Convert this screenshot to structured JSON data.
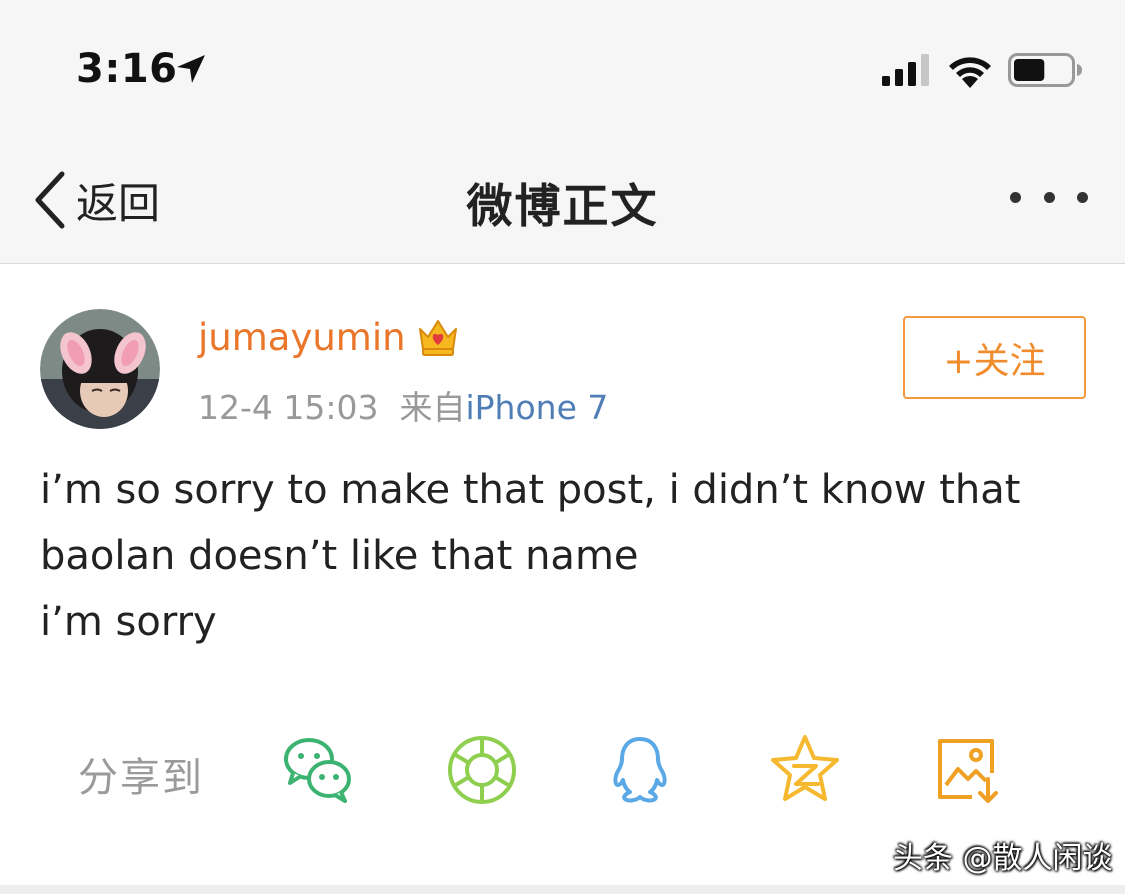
{
  "status_bar": {
    "time": "3:16",
    "location_icon": "location-arrow-icon",
    "signal_icon": "cellular-signal-icon",
    "wifi_icon": "wifi-icon",
    "battery_icon": "battery-icon",
    "battery_level": 0.55
  },
  "nav": {
    "back_label": "返回",
    "title": "微博正文",
    "more_icon": "more-dots-icon"
  },
  "post": {
    "username": "jumayumin",
    "badge_icon": "crown-icon",
    "timestamp": "12-4 15:03",
    "source_prefix": "来自",
    "device": "iPhone 7",
    "follow_label": "+关注",
    "content_lines": [
      "i’m so sorry to make that post, i didn’t know that",
      "baolan doesn’t like that name",
      "i’m sorry"
    ]
  },
  "share": {
    "label": "分享到",
    "targets": [
      {
        "name": "wechat-icon",
        "color": "#3cb371"
      },
      {
        "name": "moments-icon",
        "color": "#8fcf4f"
      },
      {
        "name": "qq-icon",
        "color": "#5aa9e6"
      },
      {
        "name": "qzone-icon",
        "color": "#f5b82e"
      },
      {
        "name": "save-image-icon",
        "color": "#f0a022"
      }
    ]
  },
  "watermark": "头条 @散人闲谈",
  "colors": {
    "accent": "#e9762a",
    "link": "#4f7db5",
    "meta": "#999999"
  }
}
